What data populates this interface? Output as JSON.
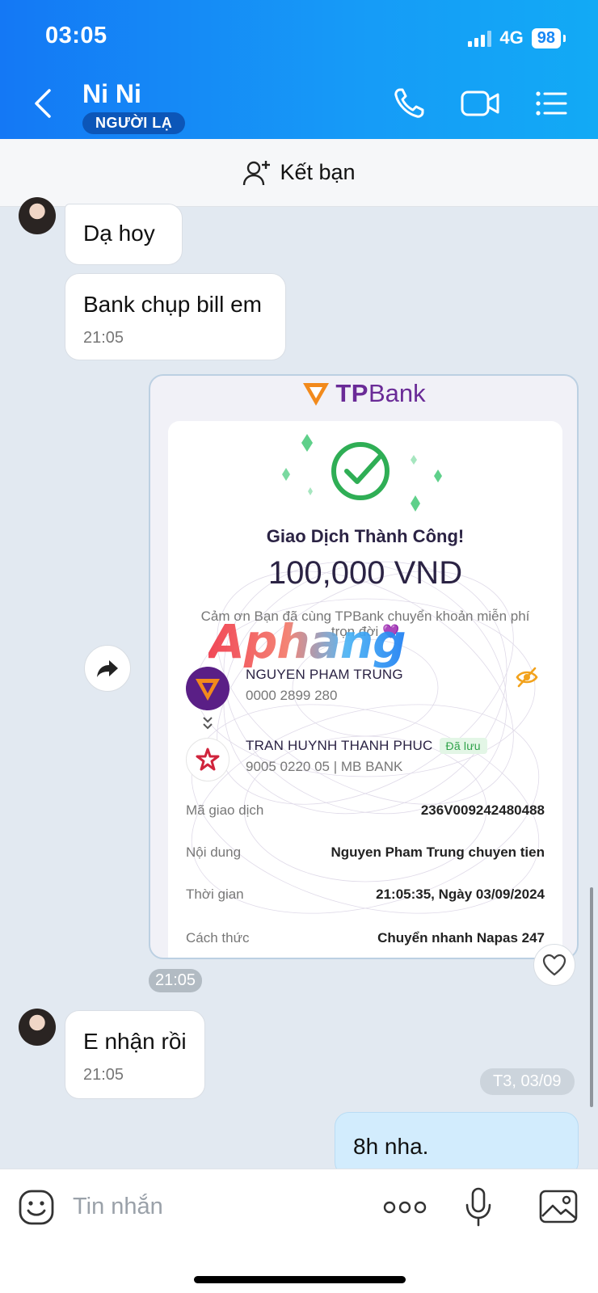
{
  "status_bar": {
    "time": "03:05",
    "network": "4G",
    "battery": "98"
  },
  "header": {
    "contact_name": "Ni Ni",
    "badge": "NGƯỜI LẠ"
  },
  "friend_bar": {
    "label": "Kết bạn"
  },
  "messages": [
    {
      "side": "left",
      "text": "Dạ hoy"
    },
    {
      "side": "left",
      "text": "Bank chụp bill em",
      "time": "21:05"
    },
    {
      "side": "left",
      "text": "E nhận rồi",
      "time": "21:05"
    },
    {
      "side": "right",
      "text": "8h nha."
    }
  ],
  "receipt": {
    "brand": {
      "tp": "TP",
      "bank": "Bank"
    },
    "title": "Giao Dịch Thành Công!",
    "amount": "100,000 VND",
    "thanks": "Cảm ơn Bạn đã cùng TPBank chuyển khoản miễn phí trọn đời 💜",
    "sender": {
      "name": "NGUYEN PHAM TRUNG",
      "account": "0000 2899 280"
    },
    "receiver": {
      "name": "TRAN HUYNH THANH PHUC",
      "saved_tag": "Đã lưu",
      "account": "9005 0220 05 | MB BANK"
    },
    "rows": [
      {
        "label": "Mã giao dịch",
        "value": "236V009242480488"
      },
      {
        "label": "Nội dung",
        "value": "Nguyen Pham Trung chuyen tien"
      },
      {
        "label": "Thời gian",
        "value": "21:05:35, Ngày 03/09/2024"
      },
      {
        "label": "Cách thức",
        "value": "Chuyển nhanh Napas 247"
      }
    ],
    "time": "21:05"
  },
  "watermark": "Aphang",
  "date_separator": "T3, 03/09",
  "input": {
    "placeholder": "Tin nhắn"
  },
  "icons": {
    "back": "chevron-left-icon",
    "call": "phone-icon",
    "video": "video-icon",
    "menu": "list-icon",
    "add_friend": "add-user-icon",
    "share": "share-icon",
    "like": "heart-icon",
    "emoji": "emoji-icon",
    "more": "more-dots-icon",
    "mic": "microphone-icon",
    "image": "image-icon"
  },
  "colors": {
    "header_start": "#1478f5",
    "header_end": "#12aaf5",
    "sent_bubble": "#d2ecfd",
    "tp_purple": "#6a2b97",
    "success_green": "#2fae55"
  }
}
